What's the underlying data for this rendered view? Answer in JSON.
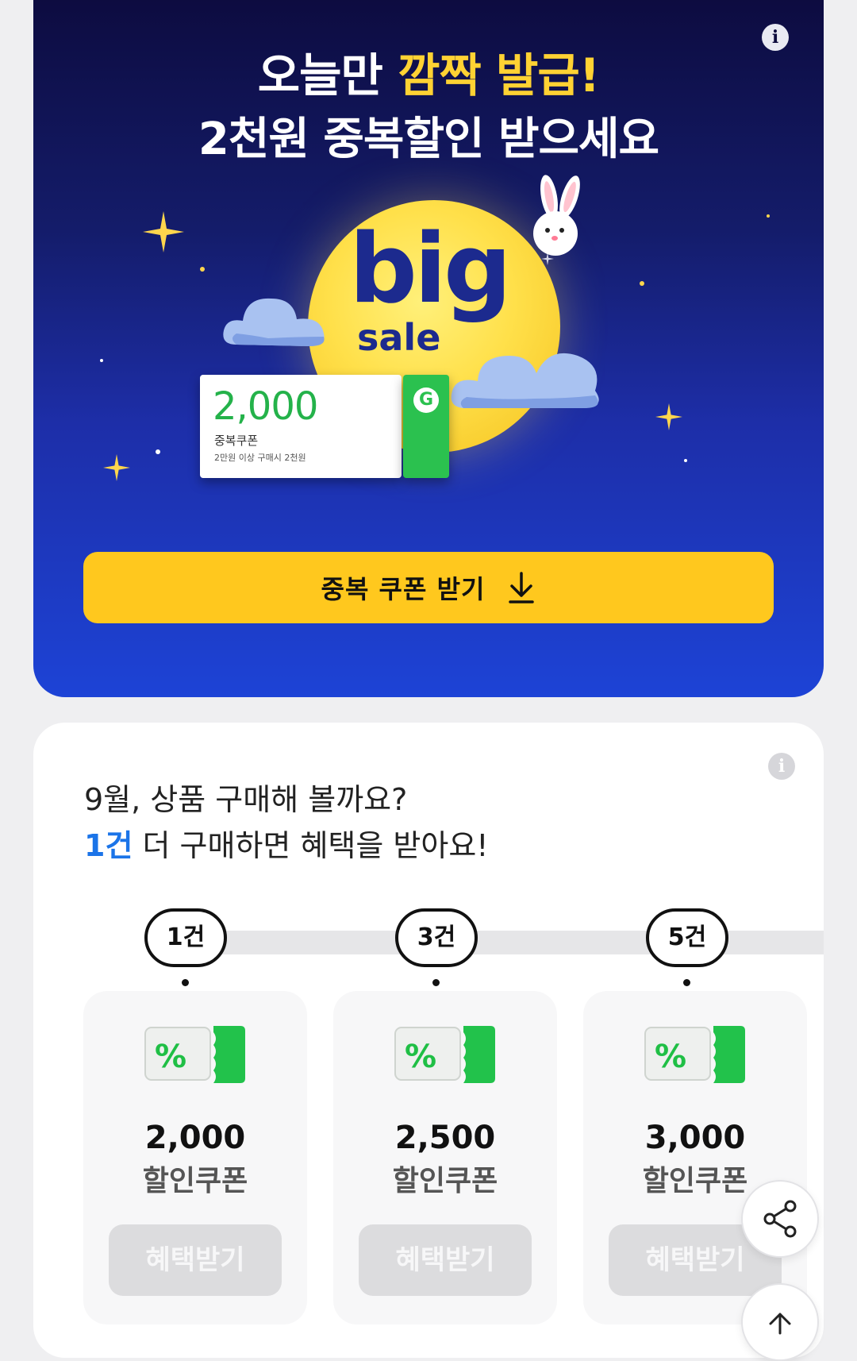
{
  "banner": {
    "headline_line1_part1": "오늘만",
    "headline_line1_part2": "깜짝 발급!",
    "headline_line2": "2천원 중복할인 받으세요",
    "big_text": "big",
    "sale_text": "sale",
    "coupon": {
      "amount": "2,000",
      "name": "중복쿠폰",
      "condition": "2만원 이상 구매시 2천원",
      "stub_letter": "G"
    },
    "cta_label": "중복 쿠폰 받기",
    "info_glyph": "i"
  },
  "benefits": {
    "title_line1": "9월, 상품 구매해 볼까요?",
    "title_line2_highlight": "1건",
    "title_line2_rest": " 더 구매하면 혜택을 받아요!",
    "info_glyph": "i",
    "tiers": [
      {
        "count": "1건",
        "amount": "2,000",
        "label": "할인쿠폰",
        "button": "혜택받기"
      },
      {
        "count": "3건",
        "amount": "2,500",
        "label": "할인쿠폰",
        "button": "혜택받기"
      },
      {
        "count": "5건",
        "amount": "3,000",
        "label": "할인쿠폰",
        "button": "혜택받기"
      }
    ]
  },
  "fab_icons": [
    "share-icon",
    "scroll-top-icon"
  ],
  "colors": {
    "banner_top": "#0c0a3c",
    "banner_bottom": "#1d43d6",
    "accent_yellow": "#ffc81e",
    "highlight_blue": "#1b74e8",
    "coupon_green": "#2bc14f"
  }
}
